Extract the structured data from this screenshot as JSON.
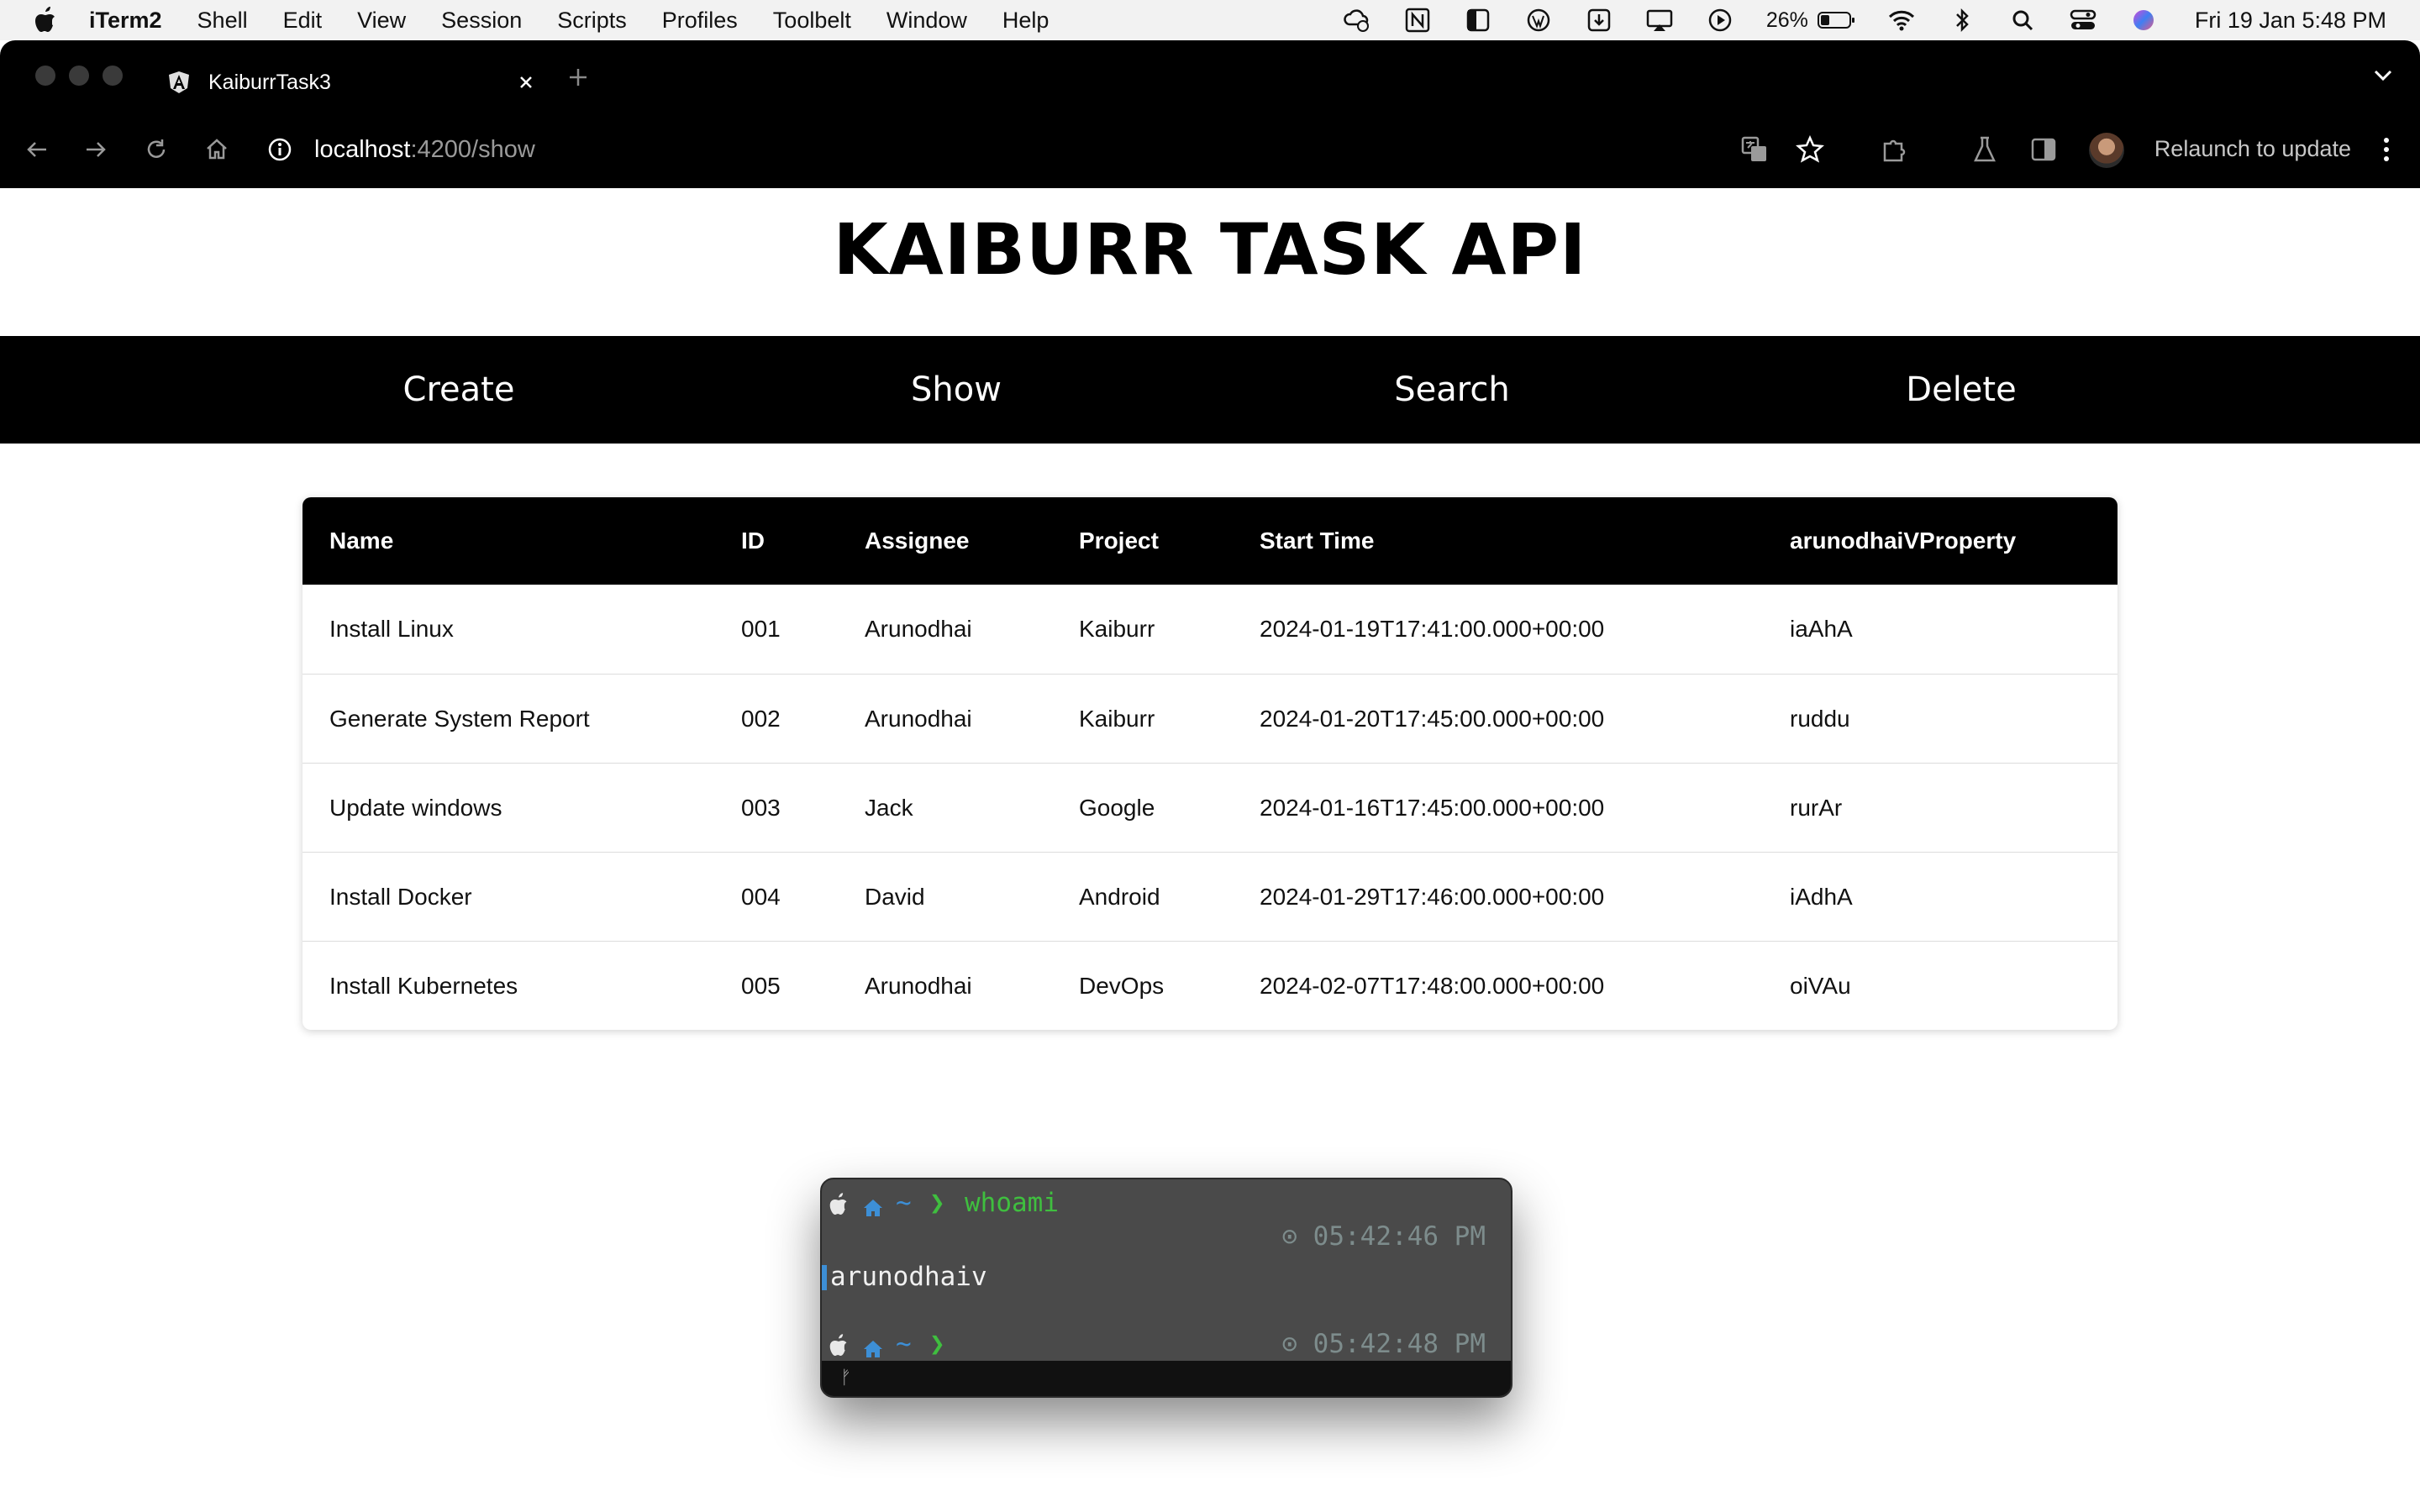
{
  "menubar": {
    "app_name": "iTerm2",
    "items": [
      "Shell",
      "Edit",
      "View",
      "Session",
      "Scripts",
      "Profiles",
      "Toolbelt",
      "Window",
      "Help"
    ],
    "battery_percent": "26%",
    "clock": "Fri 19 Jan  5:48 PM"
  },
  "browser": {
    "tab_title": "KaiburrTask3",
    "url_host": "localhost",
    "url_path": ":4200/show",
    "relaunch_label": "Relaunch to update"
  },
  "page": {
    "title": "KAIBURR TASK API",
    "nav": [
      "Create",
      "Show",
      "Search",
      "Delete"
    ],
    "table": {
      "columns": [
        "Name",
        "ID",
        "Assignee",
        "Project",
        "Start Time",
        "arunodhaiVProperty"
      ],
      "rows": [
        [
          "Install Linux",
          "001",
          "Arunodhai",
          "Kaiburr",
          "2024-01-19T17:41:00.000+00:00",
          "iaAhA"
        ],
        [
          "Generate System Report",
          "002",
          "Arunodhai",
          "Kaiburr",
          "2024-01-20T17:45:00.000+00:00",
          "ruddu"
        ],
        [
          "Update windows",
          "003",
          "Jack",
          "Google",
          "2024-01-16T17:45:00.000+00:00",
          "rurAr"
        ],
        [
          "Install Docker",
          "004",
          "David",
          "Android",
          "2024-01-29T17:46:00.000+00:00",
          "iAdhA"
        ],
        [
          "Install Kubernetes",
          "005",
          "Arunodhai",
          "DevOps",
          "2024-02-07T17:48:00.000+00:00",
          "oiVAu"
        ]
      ]
    }
  },
  "terminal": {
    "prompt_tilde": "~",
    "prompt_arrow": "❯",
    "command": "whoami",
    "time1": "⊙ 05:42:46 PM",
    "output": "arunodhaiv",
    "time2": "⊙ 05:42:48 PM",
    "status_glyph": "ᚠ"
  },
  "colors": {
    "navbar_bg": "#000000",
    "table_header_bg": "#000000",
    "terminal_bg": "#4a4a4a",
    "prompt_green": "#3fbf3f",
    "prompt_blue": "#3d8fd6"
  }
}
